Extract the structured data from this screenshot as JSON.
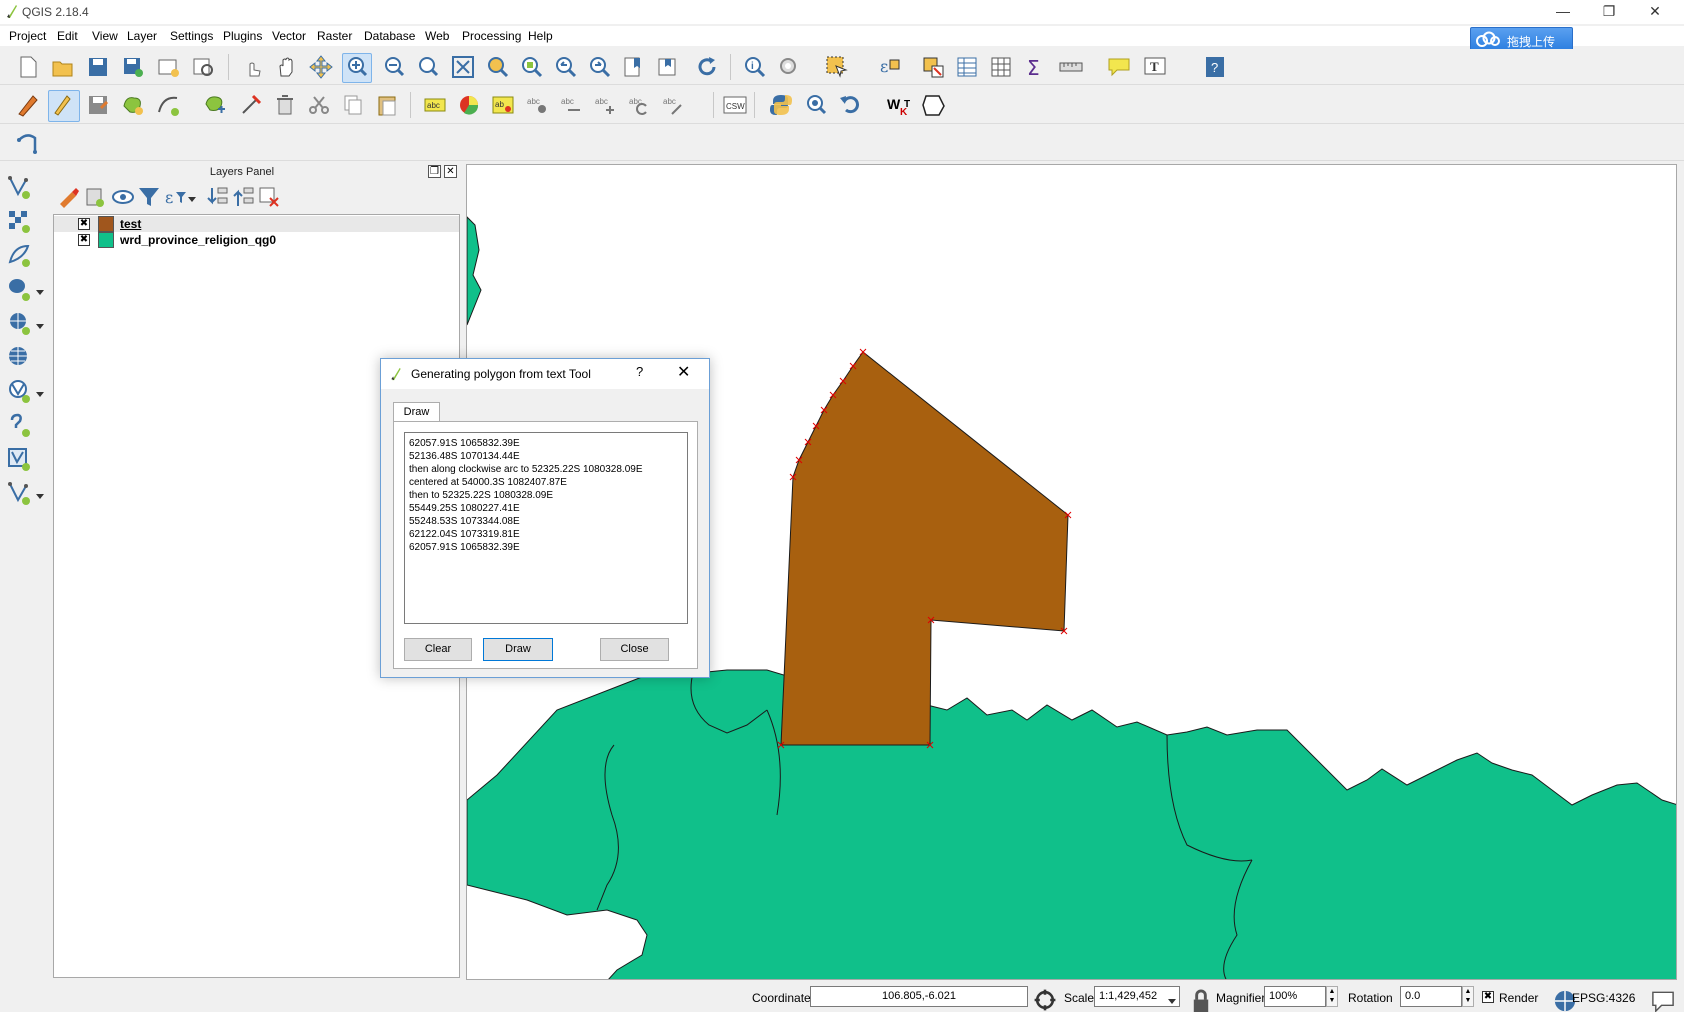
{
  "window": {
    "title": "QGIS 2.18.4"
  },
  "menubar": {
    "items": [
      "Project",
      "Edit",
      "View",
      "Layer",
      "Settings",
      "Plugins",
      "Vector",
      "Raster",
      "Database",
      "Web",
      "Processing",
      "Help"
    ]
  },
  "cloud_button": {
    "label": "拖拽上传"
  },
  "layers_panel": {
    "title": "Layers Panel",
    "layers": [
      {
        "name": "test",
        "checked": "✖",
        "swatch_color": "#a0561d"
      },
      {
        "name": "wrd_province_religion_qg0",
        "checked": "✖",
        "swatch_color": "#10c08a"
      }
    ]
  },
  "dialog": {
    "title": "Generating polygon from text Tool",
    "help": "?",
    "tab": "Draw",
    "text": "62057.91S 1065832.39E\n52136.48S 1070134.44E\nthen along clockwise arc to 52325.22S 1080328.09E\ncentered at 54000.3S 1082407.87E\nthen to 52325.22S 1080328.09E\n55449.25S 1080227.41E\n55248.53S 1073344.08E\n62122.04S 1073319.81E\n62057.91S 1065832.39E",
    "buttons": {
      "clear": "Clear",
      "draw": "Draw",
      "close": "Close"
    }
  },
  "statusbar": {
    "coordinate_label": "Coordinate",
    "coordinate_value": "106.805,-6.021",
    "scale_label": "Scale",
    "scale_value": "1:1,429,452",
    "magnifier_label": "Magnifier",
    "magnifier_value": "100%",
    "rotation_label": "Rotation",
    "rotation_value": "0.0",
    "render_label": "Render",
    "render_checked": "✖",
    "crs": "EPSG:4326"
  },
  "colors": {
    "land": "#10c08a",
    "polygon": "#a8600f",
    "accent": "#0078d7"
  }
}
